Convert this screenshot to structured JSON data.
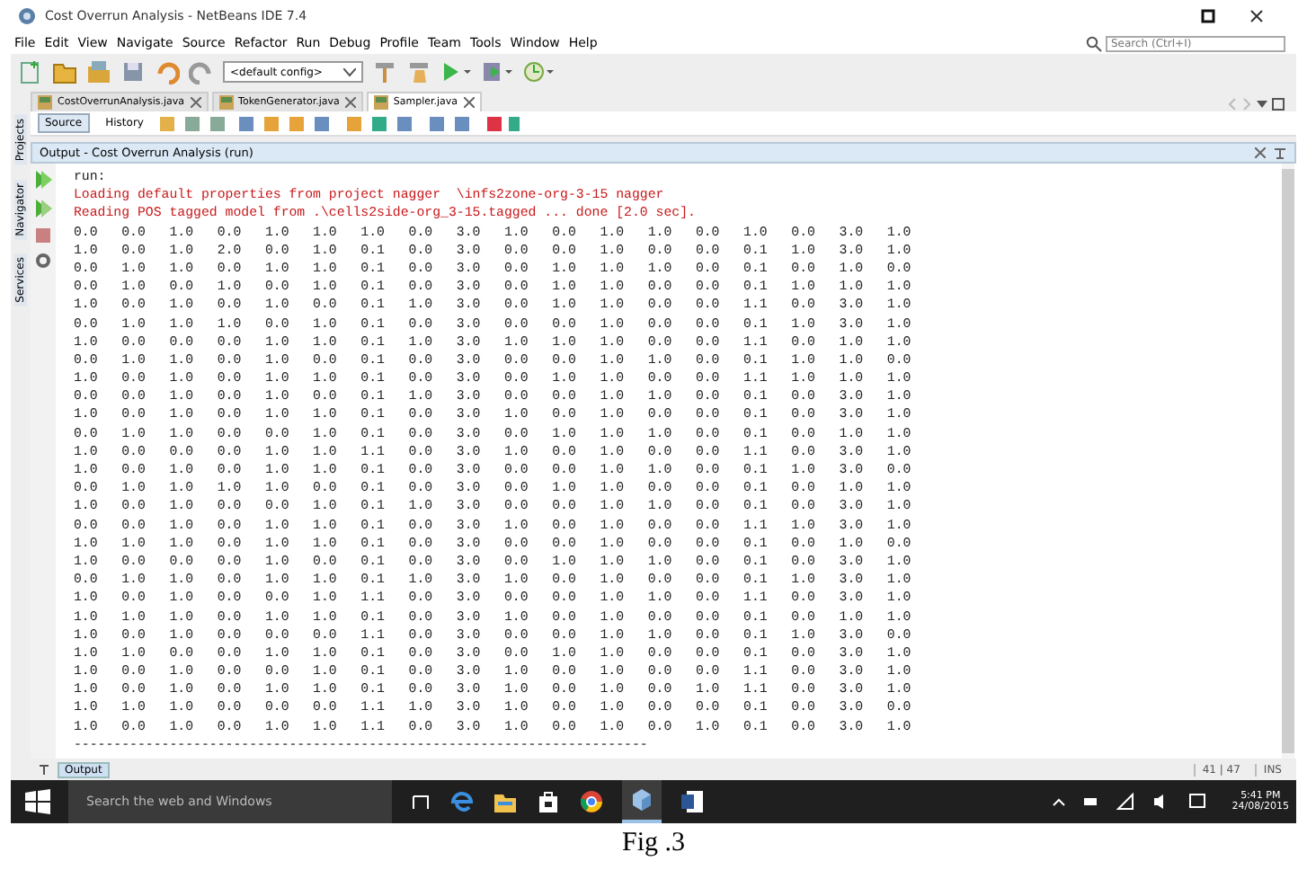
{
  "window": {
    "title": "Cost Overrun Analysis - NetBeans IDE 7.4"
  },
  "menu": [
    "File",
    "Edit",
    "View",
    "Navigate",
    "Source",
    "Refactor",
    "Run",
    "Debug",
    "Profile",
    "Team",
    "Tools",
    "Window",
    "Help"
  ],
  "toolbar": {
    "config": "<default config>"
  },
  "search": {
    "placeholder": "Search (Ctrl+I)"
  },
  "editor_tabs": [
    {
      "label": "CostOverrunAnalysis.java",
      "selected": false
    },
    {
      "label": "TokenGenerator.java",
      "selected": false
    },
    {
      "label": "Sampler.java",
      "selected": true
    }
  ],
  "editor_modes": [
    {
      "label": "Source",
      "selected": true
    },
    {
      "label": "History",
      "selected": false
    }
  ],
  "side_tabs": [
    "Projects",
    "Navigator",
    "Services"
  ],
  "output": {
    "title": "Output - Cost Overrun Analysis (run)",
    "lines": [
      {
        "kind": "plain",
        "text": "run:"
      },
      {
        "kind": "error",
        "text": "Loading default properties from project nagger  \\infs2zone-org-3-15 nagger"
      },
      {
        "kind": "error",
        "text": "Reading POS tagged model from .\\cells2side-org_3-15.tagged ... done [2.0 sec]."
      },
      {
        "kind": "plain",
        "text": "0.0   0.0   1.0   0.0   1.0   1.0   1.0   0.0   3.0   1.0   0.0   1.0   1.0   0.0   1.0   0.0   3.0   1.0"
      },
      {
        "kind": "plain",
        "text": "1.0   0.0   1.0   2.0   0.0   1.0   0.1   0.0   3.0   0.0   0.0   1.0   0.0   0.0   0.1   1.0   3.0   1.0"
      },
      {
        "kind": "plain",
        "text": "0.0   1.0   1.0   0.0   1.0   1.0   0.1   0.0   3.0   0.0   1.0   1.0   1.0   0.0   0.1   0.0   1.0   0.0"
      },
      {
        "kind": "plain",
        "text": "0.0   1.0   0.0   1.0   0.0   1.0   0.1   0.0   3.0   0.0   1.0   1.0   0.0   0.0   0.1   1.0   1.0   1.0"
      },
      {
        "kind": "plain",
        "text": "1.0   0.0   1.0   0.0   1.0   0.0   0.1   1.0   3.0   0.0   1.0   1.0   0.0   0.0   1.1   0.0   3.0   1.0"
      },
      {
        "kind": "plain",
        "text": "0.0   1.0   1.0   1.0   0.0   1.0   0.1   0.0   3.0   0.0   0.0   1.0   0.0   0.0   0.1   1.0   3.0   1.0"
      },
      {
        "kind": "plain",
        "text": "1.0   0.0   0.0   0.0   1.0   1.0   0.1   1.0   3.0   1.0   1.0   1.0   0.0   0.0   1.1   0.0   1.0   1.0"
      },
      {
        "kind": "plain",
        "text": "0.0   1.0   1.0   0.0   1.0   0.0   0.1   0.0   3.0   0.0   0.0   1.0   1.0   0.0   0.1   1.0   1.0   0.0"
      },
      {
        "kind": "plain",
        "text": "1.0   0.0   1.0   0.0   1.0   1.0   0.1   0.0   3.0   0.0   1.0   1.0   0.0   0.0   1.1   1.0   1.0   1.0"
      },
      {
        "kind": "plain",
        "text": "0.0   0.0   1.0   0.0   1.0   0.0   0.1   1.0   3.0   0.0   0.0   1.0   1.0   0.0   0.1   0.0   3.0   1.0"
      },
      {
        "kind": "plain",
        "text": "1.0   0.0   1.0   0.0   1.0   1.0   0.1   0.0   3.0   1.0   0.0   1.0   0.0   0.0   0.1   0.0   3.0   1.0"
      },
      {
        "kind": "plain",
        "text": "0.0   1.0   1.0   0.0   0.0   1.0   0.1   0.0   3.0   0.0   1.0   1.0   1.0   0.0   0.1   0.0   1.0   1.0"
      },
      {
        "kind": "plain",
        "text": "1.0   0.0   0.0   0.0   1.0   1.0   1.1   0.0   3.0   1.0   0.0   1.0   0.0   0.0   1.1   0.0   3.0   1.0"
      },
      {
        "kind": "plain",
        "text": "1.0   0.0   1.0   0.0   1.0   1.0   0.1   0.0   3.0   0.0   0.0   1.0   1.0   0.0   0.1   1.0   3.0   0.0"
      },
      {
        "kind": "plain",
        "text": "0.0   1.0   1.0   1.0   1.0   0.0   0.1   0.0   3.0   0.0   1.0   1.0   0.0   0.0   0.1   0.0   1.0   1.0"
      },
      {
        "kind": "plain",
        "text": "1.0   0.0   1.0   0.0   0.0   1.0   0.1   1.0   3.0   0.0   0.0   1.0   1.0   0.0   0.1   0.0   3.0   1.0"
      },
      {
        "kind": "plain",
        "text": "0.0   0.0   1.0   0.0   1.0   1.0   0.1   0.0   3.0   1.0   0.0   1.0   0.0   0.0   1.1   1.0   3.0   1.0"
      },
      {
        "kind": "plain",
        "text": "1.0   1.0   1.0   0.0   1.0   1.0   0.1   0.0   3.0   0.0   0.0   1.0   0.0   0.0   0.1   0.0   1.0   0.0"
      },
      {
        "kind": "plain",
        "text": "1.0   0.0   0.0   0.0   1.0   0.0   0.1   0.0   3.0   0.0   1.0   1.0   1.0   0.0   0.1   0.0   3.0   1.0"
      },
      {
        "kind": "plain",
        "text": "0.0   1.0   1.0   0.0   1.0   1.0   0.1   1.0   3.0   1.0   0.0   1.0   0.0   0.0   0.1   1.0   3.0   1.0"
      },
      {
        "kind": "plain",
        "text": "1.0   0.0   1.0   0.0   0.0   1.0   1.1   0.0   3.0   0.0   0.0   1.0   1.0   0.0   1.1   0.0   3.0   1.0"
      },
      {
        "kind": "plain",
        "text": "1.0   1.0   1.0   0.0   1.0   1.0   0.1   0.0   3.0   1.0   0.0   1.0   0.0   0.0   0.1   0.0   1.0   1.0"
      },
      {
        "kind": "plain",
        "text": "1.0   0.0   1.0   0.0   0.0   0.0   1.1   0.0   3.0   0.0   0.0   1.0   1.0   0.0   0.1   1.0   3.0   0.0"
      },
      {
        "kind": "plain",
        "text": "1.0   1.0   0.0   0.0   1.0   1.0   0.1   0.0   3.0   0.0   1.0   1.0   0.0   0.0   0.1   0.0   3.0   1.0"
      },
      {
        "kind": "plain",
        "text": "1.0   0.0   1.0   0.0   0.0   1.0   0.1   0.0   3.0   1.0   0.0   1.0   0.0   0.0   1.1   0.0   3.0   1.0"
      },
      {
        "kind": "plain",
        "text": "1.0   0.0   1.0   0.0   1.0   1.0   0.1   0.0   3.0   1.0   0.0   1.0   0.0   1.0   1.1   0.0   3.0   1.0"
      },
      {
        "kind": "plain",
        "text": "1.0   1.0   1.0   0.0   0.0   0.0   1.1   1.0   3.0   1.0   0.0   1.0   0.0   0.0   0.1   0.0   3.0   0.0"
      },
      {
        "kind": "plain",
        "text": "1.0   0.0   1.0   0.0   1.0   1.0   1.1   0.0   3.0   1.0   0.0   1.0   0.0   1.0   0.1   0.0   3.0   1.0"
      },
      {
        "kind": "plain",
        "text": "------------------------------------------------------------------------"
      }
    ]
  },
  "bottom_tabs": [
    {
      "label": "Output",
      "selected": true
    }
  ],
  "status_bar": {
    "position": "41 | 47",
    "mode": "INS"
  },
  "taskbar": {
    "search_placeholder": "Search the web and Windows",
    "time": "5:41 PM",
    "date": "24/08/2015"
  },
  "caption": "Fig .3"
}
